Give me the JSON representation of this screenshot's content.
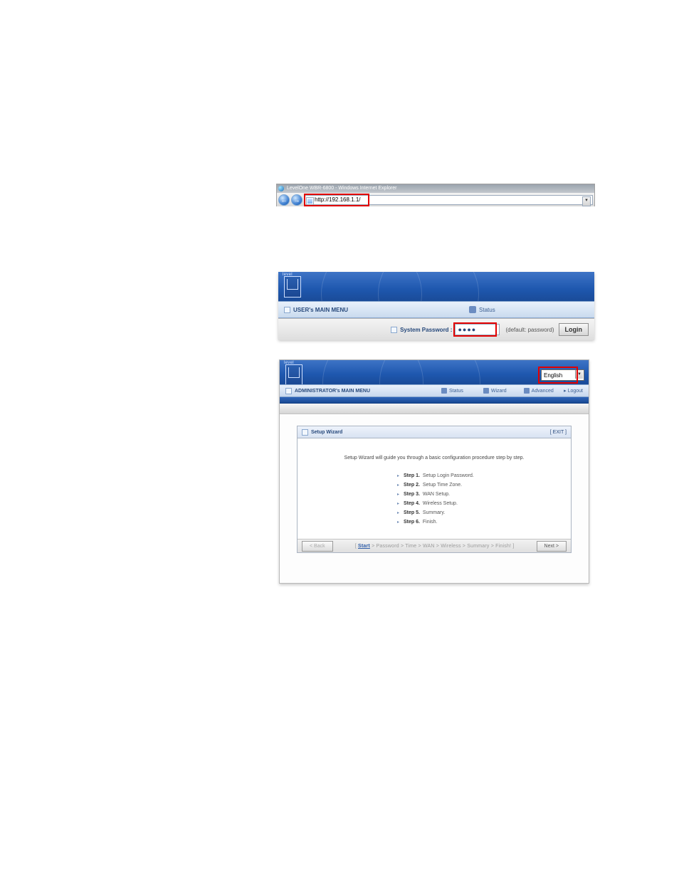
{
  "ie": {
    "window_title": "LevelOne WBR-6800 - Windows Internet Explorer",
    "url": "http://192.168.1.1/"
  },
  "login": {
    "logo_brand": "level",
    "menu_title": "USER's MAIN MENU",
    "status_label": "Status",
    "password_label": "System Password :",
    "password_value": "●●●●",
    "password_hint": "(default: password)",
    "login_button": "Login"
  },
  "admin": {
    "logo_brand": "level",
    "language_selected": "English",
    "menu_title": "ADMINISTRATOR's MAIN MENU",
    "nav": {
      "status": "Status",
      "wizard": "Wizard",
      "advanced": "Advanced",
      "logout": "Logout"
    },
    "panel_title": "Setup Wizard",
    "exit_label": "[ EXIT ]",
    "intro": "Setup Wizard will guide you through a basic configuration procedure step by step.",
    "steps": [
      {
        "label": "Step 1.",
        "text": "Setup Login Password."
      },
      {
        "label": "Step 2.",
        "text": "Setup Time Zone."
      },
      {
        "label": "Step 3.",
        "text": "WAN Setup."
      },
      {
        "label": "Step 4.",
        "text": "Wireless Setup."
      },
      {
        "label": "Step 5.",
        "text": "Summary."
      },
      {
        "label": "Step 6.",
        "text": "Finish."
      }
    ],
    "back_button": "< Back",
    "next_button": "Next >",
    "breadcrumb": {
      "open": "[ ",
      "current": "Start",
      "rest": " > Password > Time > WAN > Wireless > Summary > Finish! ]"
    }
  }
}
